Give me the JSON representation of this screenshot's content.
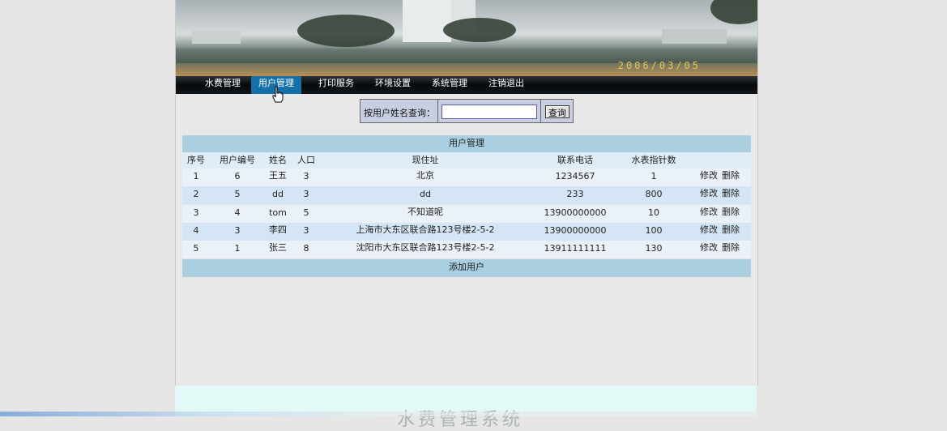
{
  "banner": {
    "date_text": "2006/03/05"
  },
  "nav": {
    "items": [
      {
        "label": "水费管理"
      },
      {
        "label": "用户管理"
      },
      {
        "label": "打印服务"
      },
      {
        "label": "环境设置"
      },
      {
        "label": "系统管理"
      },
      {
        "label": "注销退出"
      }
    ],
    "active_index": 1
  },
  "search": {
    "label": "按用户姓名查询：",
    "value": "",
    "button_label": "查询"
  },
  "table": {
    "title": "用户管理",
    "headers": [
      "序号",
      "用户编号",
      "姓名",
      "人口",
      "现住址",
      "联系电话",
      "水表指针数"
    ],
    "rows": [
      {
        "seq": "1",
        "id": "6",
        "name": "王五",
        "people": "3",
        "address": "北京",
        "phone": "1234567",
        "meter": "1"
      },
      {
        "seq": "2",
        "id": "5",
        "name": "dd",
        "people": "3",
        "address": "dd",
        "phone": "233",
        "meter": "800"
      },
      {
        "seq": "3",
        "id": "4",
        "name": "tom",
        "people": "5",
        "address": "不知道呢",
        "phone": "13900000000",
        "meter": "10"
      },
      {
        "seq": "4",
        "id": "3",
        "name": "李四",
        "people": "3",
        "address": "上海市大东区联合路123号楼2-5-2",
        "phone": "13900000000",
        "meter": "100"
      },
      {
        "seq": "5",
        "id": "1",
        "name": "张三",
        "people": "8",
        "address": "沈阳市大东区联合路123号楼2-5-2",
        "phone": "13911111111",
        "meter": "130"
      }
    ],
    "edit_label": "修改",
    "delete_label": "删除",
    "add_label": "添加用户"
  },
  "footer": {
    "partial_title": "水费管理系统"
  },
  "colors": {
    "header_band": "#a9cfe0",
    "nav_active": "#1670a8",
    "footer_band": "#e3f9f7"
  }
}
